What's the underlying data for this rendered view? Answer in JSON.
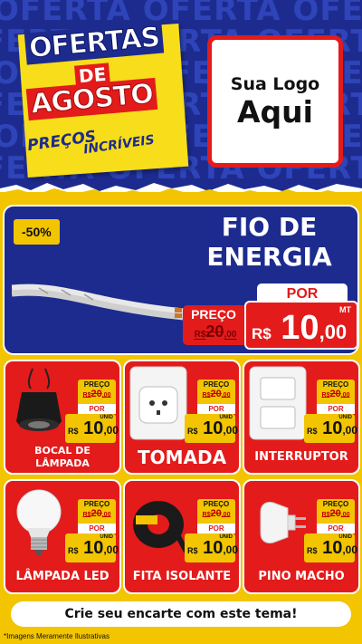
{
  "header": {
    "background_word": "OFERTA",
    "title_line1": "OFERTAS",
    "title_line2": "DE",
    "title_line3": "AGOSTO",
    "subtitle_line1": "PREÇOS",
    "subtitle_line2": "INCRÍVEIS",
    "logo_line1": "Sua Logo",
    "logo_line2": "Aqui"
  },
  "featured": {
    "discount_badge": "-50%",
    "title_line1": "FIO DE",
    "title_line2": "ENERGIA",
    "por_label": "POR",
    "preco_label": "PREÇO",
    "old_currency": "R$",
    "old_int": "20",
    "old_cents": ",00",
    "unit": "MT",
    "currency": "R$",
    "price_int": "10",
    "price_cents": ",00"
  },
  "card_labels": {
    "preco": "PREÇO",
    "por": "POR",
    "unid": "UNID",
    "currency": "R$",
    "old_int": "20",
    "old_cents": ",00",
    "new_int": "10",
    "new_cents": ",00"
  },
  "products": [
    {
      "name_line1": "BOCAL DE",
      "name_line2": "LÂMPADA",
      "icon": "lamp-socket-icon"
    },
    {
      "name_line1": "TOMADA",
      "name_line2": "",
      "icon": "power-outlet-icon"
    },
    {
      "name_line1": "INTERRUPTOR",
      "name_line2": "",
      "icon": "light-switch-icon"
    },
    {
      "name_line1": "LÂMPADA LED",
      "name_line2": "",
      "icon": "led-bulb-icon"
    },
    {
      "name_line1": "FITA ISOLANTE",
      "name_line2": "",
      "icon": "insulating-tape-icon"
    },
    {
      "name_line1": "PINO MACHO",
      "name_line2": "",
      "icon": "plug-icon"
    }
  ],
  "cta": "Crie seu encarte com este tema!",
  "disclaimer": "*Imagens Meramente Ilustrativas",
  "colors": {
    "navy": "#1d2b8f",
    "red": "#e31b1b",
    "yellow": "#f2c500",
    "white": "#ffffff"
  }
}
